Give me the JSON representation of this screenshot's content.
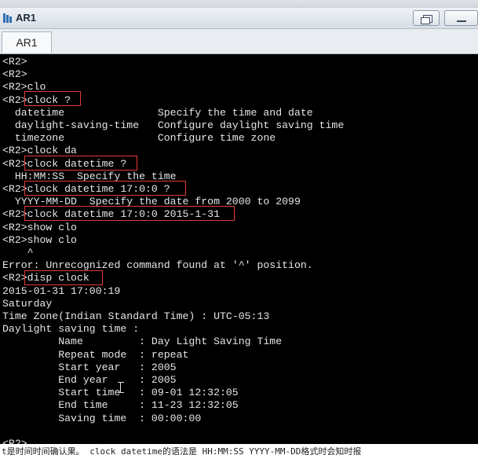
{
  "window": {
    "title": "AR1"
  },
  "tabs": [
    {
      "label": "AR1"
    }
  ],
  "terminal": {
    "lines": [
      "<R2>",
      "<R2>",
      "<R2>clo",
      "<R2>clock ?",
      "  datetime               Specify the time and date",
      "  daylight-saving-time   Configure daylight saving time",
      "  timezone               Configure time zone",
      "<R2>clock da",
      "<R2>clock datetime ?",
      "  HH:MM:SS  Specify the time",
      "<R2>clock datetime 17:0:0 ?",
      "  YYYY-MM-DD  Specify the date from 2000 to 2099",
      "<R2>clock datetime 17:0:0 2015-1-31",
      "<R2>show clo",
      "<R2>show clo",
      "    ^",
      "Error: Unrecognized command found at '^' position.",
      "<R2>disp clock",
      "2015-01-31 17:00:19",
      "Saturday",
      "Time Zone(Indian Standard Time) : UTC-05:13",
      "Daylight saving time :",
      "         Name         : Day Light Saving Time",
      "         Repeat mode  : repeat",
      "         Start year   : 2005",
      "         End year     : 2005",
      "         Start time   : 09-01 12:32:05",
      "         End time     : 11-23 12:32:05",
      "         Saving time  : 00:00:00",
      "",
      "<R2>"
    ]
  },
  "bottom_caption": "t是时间时间确认果。 clock datetime的语法是 HH:MM:SS YYYY-MM-DD格式时会知时报",
  "colors": {
    "highlight": "#e23a3a",
    "terminal_bg": "#000000",
    "terminal_fg": "#e6e6e6"
  }
}
